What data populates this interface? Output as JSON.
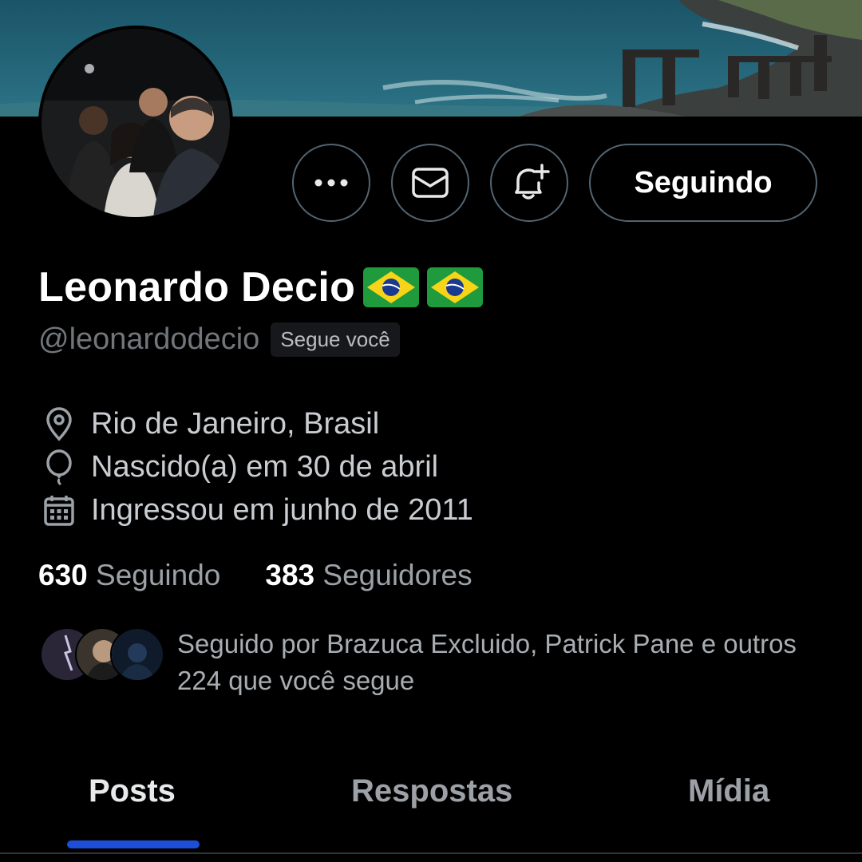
{
  "profile": {
    "display_name": "Leonardo Decio",
    "name_emojis": [
      "brazil-flag",
      "brazil-flag"
    ],
    "handle": "@leonardodecio",
    "follows_you_badge": "Segue você",
    "location": "Rio de Janeiro, Brasil",
    "birthday": "Nascido(a) em 30 de abril",
    "joined": "Ingressou em junho de 2011"
  },
  "actions": {
    "more_icon": "more-dots-icon",
    "message_icon": "envelope-icon",
    "notify_icon": "bell-plus-icon",
    "follow_label": "Seguindo"
  },
  "stats": {
    "following_count": "630",
    "following_label": "Seguindo",
    "followers_count": "383",
    "followers_label": "Seguidores"
  },
  "mutuals": {
    "text": "Seguido por Brazuca Excluido, Patrick Pane e outros 224 que você segue"
  },
  "tabs": [
    {
      "label": "Posts",
      "active": true
    },
    {
      "label": "Respostas",
      "active": false
    },
    {
      "label": "Mídia",
      "active": false
    }
  ],
  "colors": {
    "background": "#000000",
    "text_primary": "#e7e9ea",
    "text_secondary": "#71767b",
    "border": "#536471",
    "tab_indicator": "#1d4ed8",
    "flag_green": "#1f9a3c",
    "flag_yellow": "#f7d417",
    "flag_blue": "#1a3a8f"
  }
}
